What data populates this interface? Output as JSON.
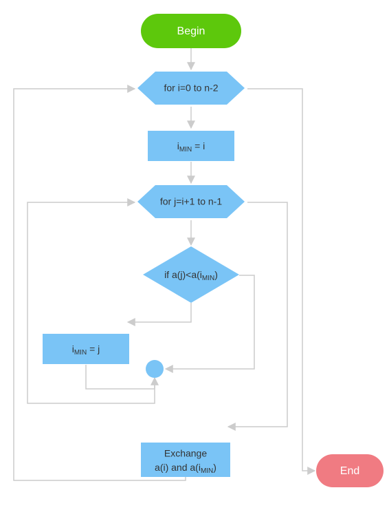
{
  "nodes": {
    "begin": "Begin",
    "for_i": "for i=0 to n-2",
    "imin_i_prefix": "i",
    "imin_i_sub": "MIN",
    "imin_i_suffix": " = i",
    "for_j": "for j=i+1 to n-1",
    "if_prefix": "if a(j)<a(i",
    "if_sub": "MIN",
    "if_suffix": ")",
    "imin_j_prefix": "i",
    "imin_j_sub": "MIN",
    "imin_j_suffix": " = j",
    "exchange_line1": "Exchange",
    "exchange_line2a": "a(i) and a(i",
    "exchange_line2_sub": "MIN",
    "exchange_line2b": ")",
    "end": "End"
  },
  "colors": {
    "green": "#5DC80C",
    "blue": "#7AC4F6",
    "red": "#F07B82",
    "line": "#CCCCCC",
    "text": "#555555"
  }
}
